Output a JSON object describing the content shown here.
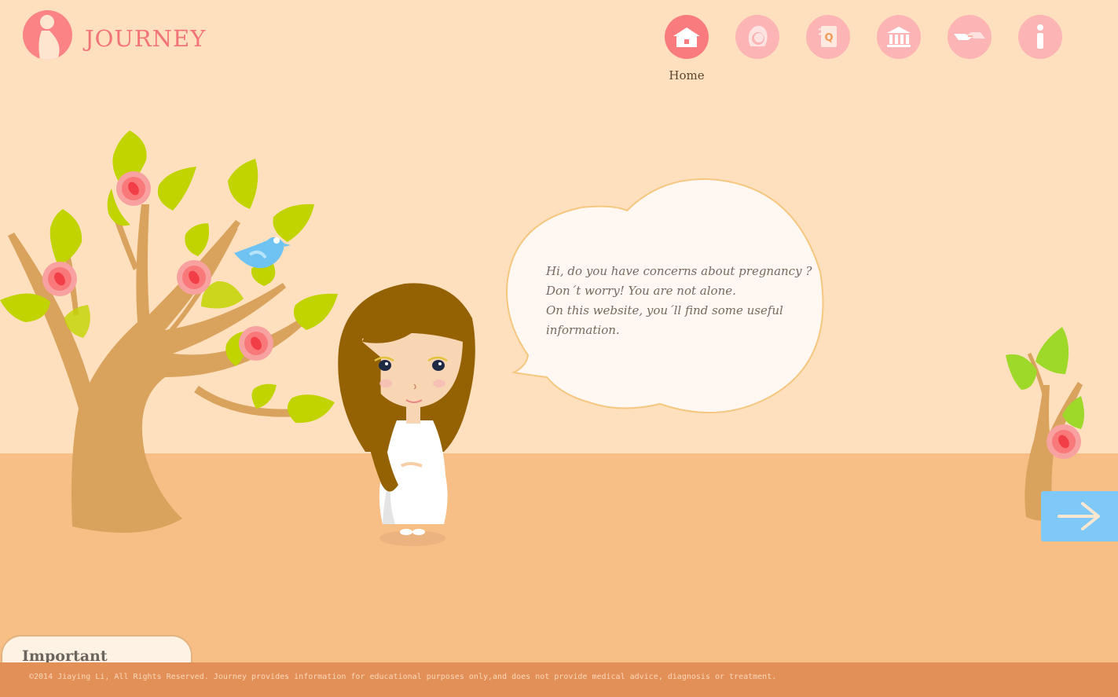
{
  "app": {
    "logo_text": "JOURNEY"
  },
  "nav": {
    "items": [
      {
        "icon": "home-icon",
        "label": "Home",
        "active": true
      },
      {
        "icon": "face-icon",
        "label": "",
        "active": false
      },
      {
        "icon": "faq-icon",
        "label": "",
        "active": false
      },
      {
        "icon": "institution-icon",
        "label": "",
        "active": false
      },
      {
        "icon": "handshake-icon",
        "label": "",
        "active": false
      },
      {
        "icon": "info-icon",
        "label": "",
        "active": false
      }
    ]
  },
  "bubble": {
    "lines": [
      "Hi, do you have concerns about pregnancy ?",
      "Don´t worry!  You are not alone.",
      "On this website,  you´ll find some useful",
      "information."
    ]
  },
  "next": {
    "icon": "arrow-right-icon"
  },
  "important_tab": {
    "label": "Important"
  },
  "footer": {
    "text": "©2014 Jiaying Li, All Rights Reserved. Journey provides information for educational purposes only,and does not provide medical advice, diagnosis or treatment."
  },
  "colors": {
    "sky": "#fee0bf",
    "ground": "#f7be85",
    "footer": "#e38f58",
    "nav_active": "#fa7b7d",
    "nav_inactive": "#fcb4b4",
    "accent_blue": "#7ec9f8"
  }
}
